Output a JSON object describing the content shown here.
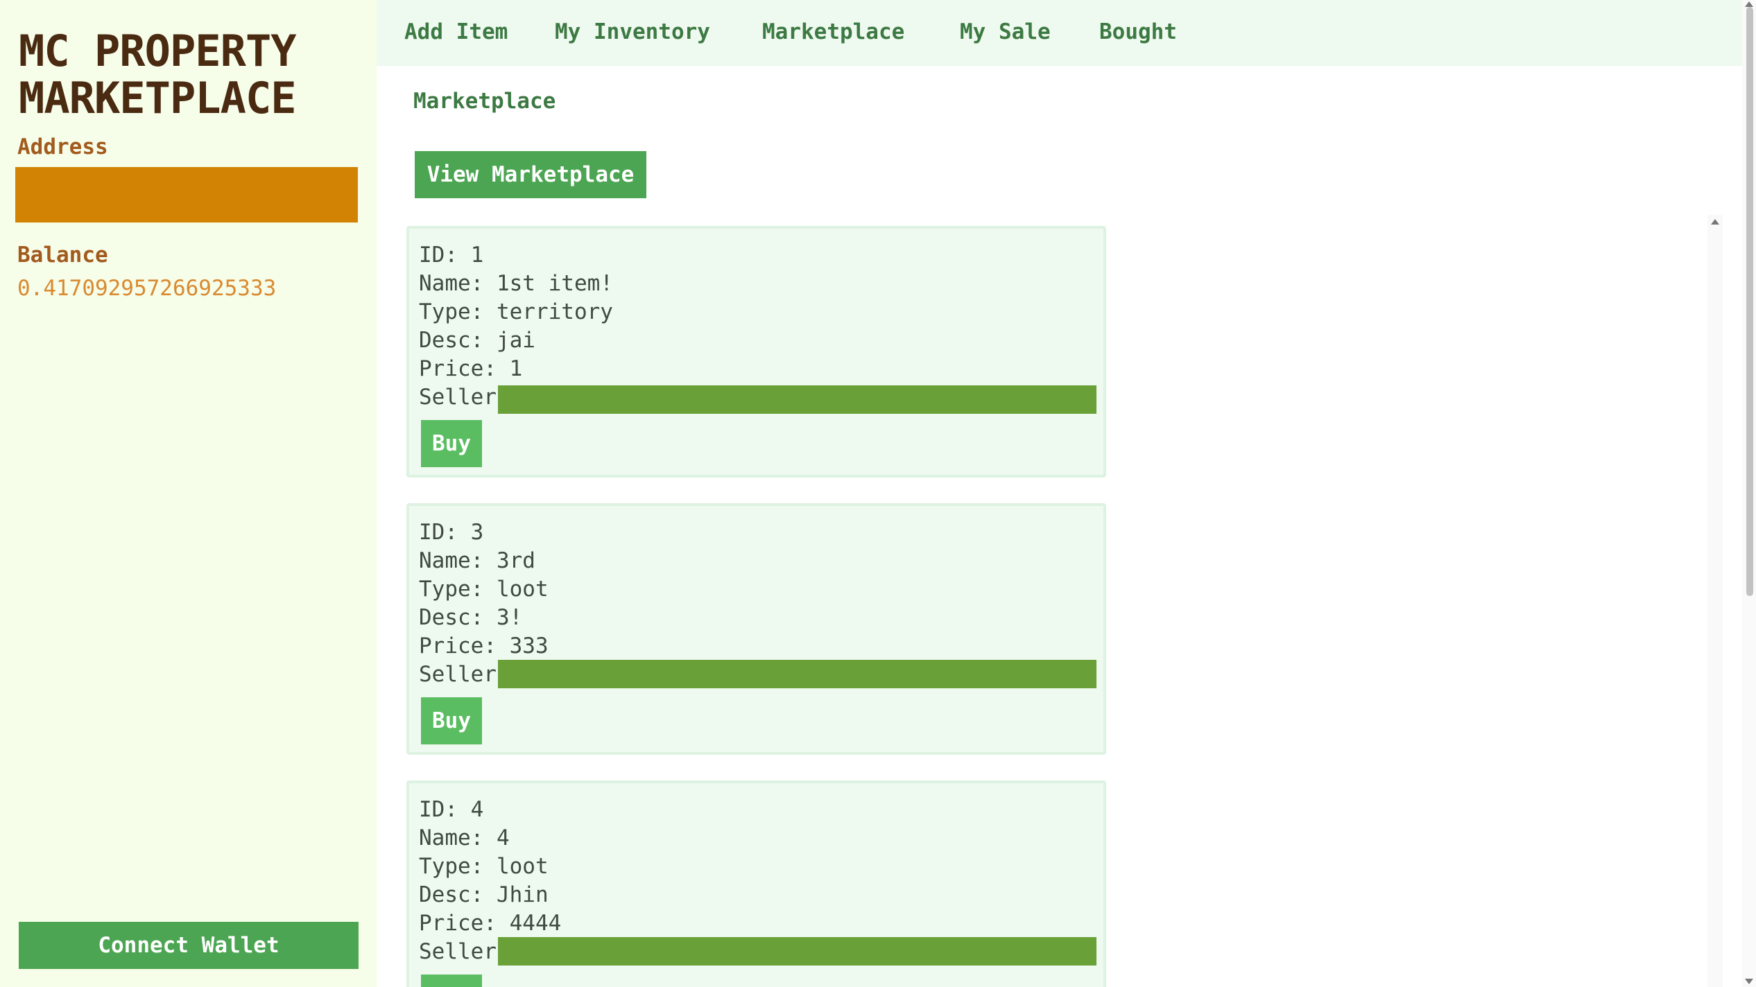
{
  "sidebar": {
    "brand": "MC PROPERTY MARKETPLACE",
    "address_label": "Address",
    "balance_label": "Balance",
    "balance_value": "0.417092957266925333",
    "connect_label": "Connect Wallet"
  },
  "nav": {
    "items": [
      "Add Item",
      "My Inventory",
      "Marketplace",
      "My Sale",
      "Bought"
    ]
  },
  "main": {
    "title": "Marketplace",
    "view_button": "View Marketplace",
    "items": [
      {
        "id": "ID: 1",
        "name": "Name: 1st item!",
        "type": "Type: territory",
        "desc": "Desc: jai",
        "price": "Price: 1",
        "seller": "Seller:",
        "buy": "Buy"
      },
      {
        "id": "ID: 3",
        "name": "Name: 3rd",
        "type": "Type: loot",
        "desc": "Desc: 3!",
        "price": "Price: 333",
        "seller": "Seller:",
        "buy": "Buy"
      },
      {
        "id": "ID: 4",
        "name": "Name: 4",
        "type": "Type: loot",
        "desc": "Desc: Jhin",
        "price": "Price: 4444",
        "seller": "Seller:",
        "buy": "Buy"
      }
    ]
  },
  "colors": {
    "sidebar_bg": "#f6fde9",
    "brand": "#4b2a12",
    "label": "#a25a1d",
    "address_fill": "#d38304",
    "accent_green": "#4ca552",
    "seller_fill": "#69a037",
    "nav_bg": "#eef9ef"
  }
}
